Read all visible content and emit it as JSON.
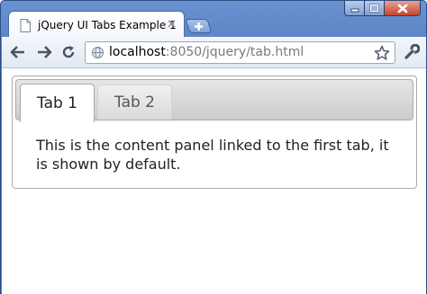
{
  "browser": {
    "tab_title": "jQuery UI Tabs Example 1",
    "url_host": "localhost",
    "url_rest": ":8050/jquery/tab.html",
    "icons": {
      "page": "page-icon",
      "tab_close": "close-icon",
      "new_tab": "plus-icon",
      "back": "back-arrow-icon",
      "forward": "forward-arrow-icon",
      "reload": "reload-icon",
      "globe": "globe-icon",
      "bookmark": "star-icon",
      "menu": "wrench-icon"
    },
    "window_buttons": [
      "minimize",
      "maximize",
      "close"
    ]
  },
  "page": {
    "tabs": [
      {
        "label": "Tab 1",
        "active": true
      },
      {
        "label": "Tab 2",
        "active": false
      }
    ],
    "panel_text": "This is the content panel linked to the first tab, it is shown by default."
  },
  "colors": {
    "frame": "#5d86c8",
    "window_close": "#c5452d",
    "tab_border": "#aaaaaa"
  }
}
